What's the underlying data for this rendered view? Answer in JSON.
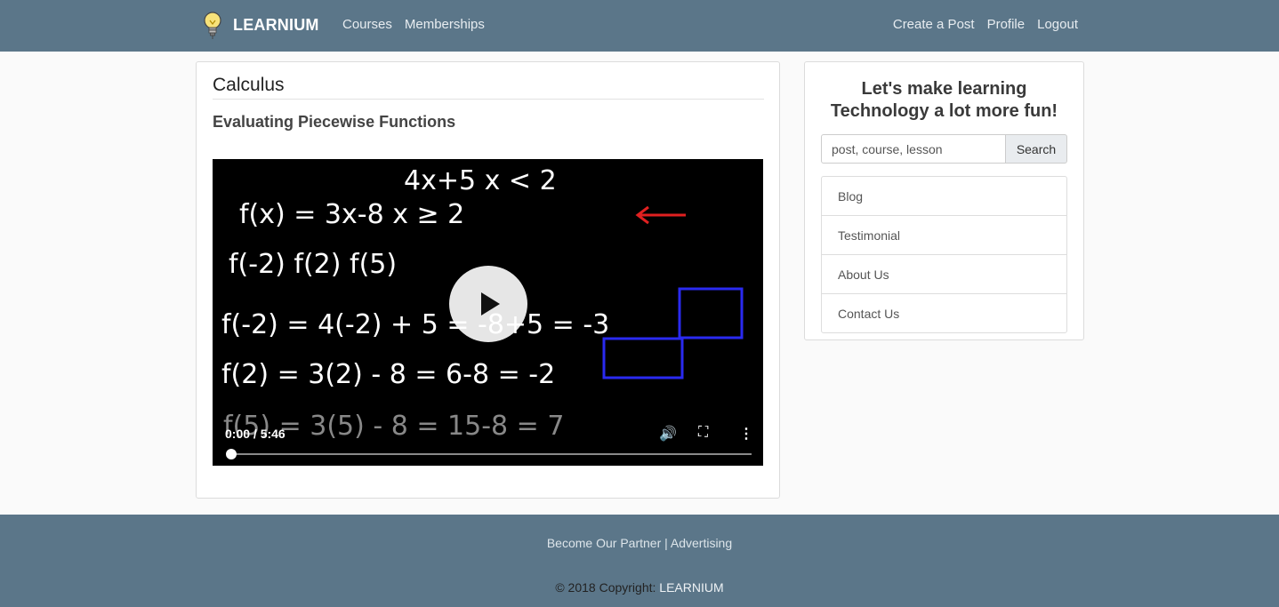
{
  "navbar": {
    "brand": "LEARNIUM",
    "left_links": [
      "Courses",
      "Memberships"
    ],
    "right_links": [
      "Create a Post",
      "Profile",
      "Logout"
    ]
  },
  "main": {
    "course_title": "Calculus",
    "lesson_title": "Evaluating Piecewise Functions",
    "video": {
      "time_display": "0:00 / 5:46",
      "progress": 0,
      "controls": [
        "play-icon",
        "volume-icon",
        "fullscreen-icon",
        "more-options-icon"
      ],
      "board_lines": [
        "4x+5    x < 2",
        "f(x) =  3x-8    x ≥ 2",
        "f(-2)   f(2)   f(5)",
        "f(-2) = 4(-2) + 5 = -8+5 = -3",
        "f(2) = 3(2) - 8 = 6-8 = -2",
        "f(5) = 3(5) - 8 = 15-8 = 7"
      ]
    }
  },
  "sidebar": {
    "tagline_line1": "Let's make learning",
    "tagline_line2": "Technology a lot more fun!",
    "search_placeholder": "post, course, lesson",
    "search_button": "Search",
    "links": [
      "Blog",
      "Testimonial",
      "About Us",
      "Contact Us"
    ]
  },
  "footer": {
    "partner_text": "Become Our Partner | Advertising",
    "copyright_prefix": "© 2018 Copyright: ",
    "copyright_brand": "LEARNIUM"
  },
  "colors": {
    "navbar_bg": "#5b7689",
    "footer_bg": "#5b7689",
    "page_bg": "#fafafa"
  }
}
